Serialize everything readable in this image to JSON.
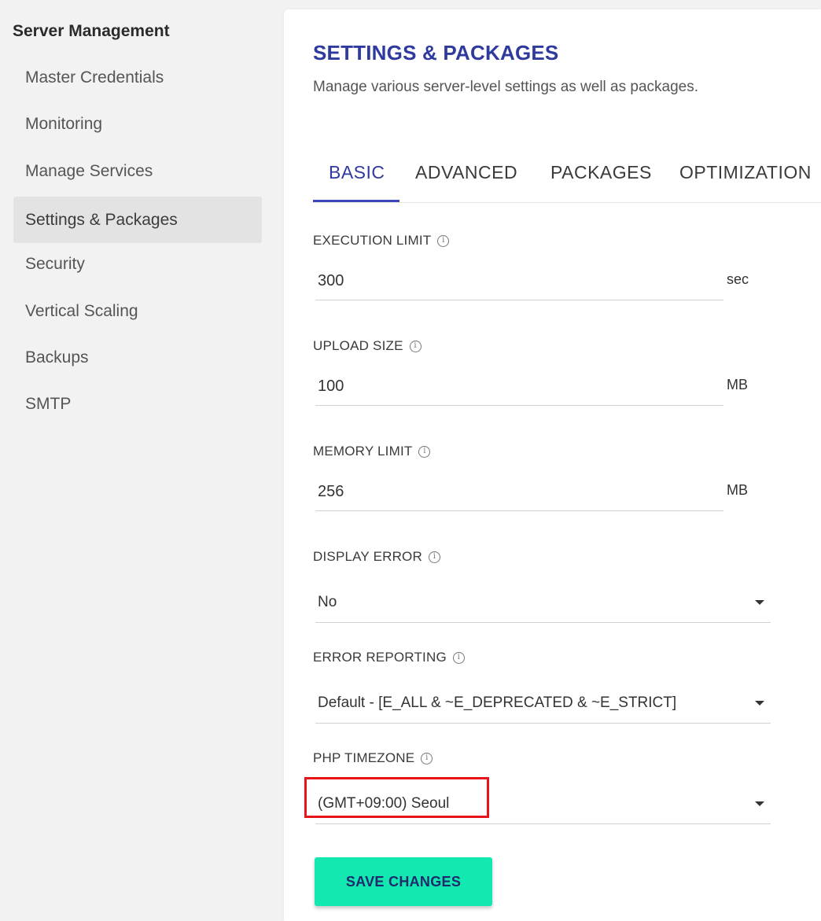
{
  "sidebar": {
    "title": "Server Management",
    "items": [
      {
        "label": "Master Credentials"
      },
      {
        "label": "Monitoring"
      },
      {
        "label": "Manage Services"
      },
      {
        "label": "Settings & Packages"
      },
      {
        "label": "Security"
      },
      {
        "label": "Vertical Scaling"
      },
      {
        "label": "Backups"
      },
      {
        "label": "SMTP"
      }
    ]
  },
  "main": {
    "title": "SETTINGS & PACKAGES",
    "subtitle": "Manage various server-level settings as well as packages.",
    "tabs": [
      {
        "label": "BASIC"
      },
      {
        "label": "ADVANCED"
      },
      {
        "label": "PACKAGES"
      },
      {
        "label": "OPTIMIZATION"
      }
    ],
    "fields": {
      "execution_limit": {
        "label": "EXECUTION LIMIT",
        "value": "300",
        "unit": "sec"
      },
      "upload_size": {
        "label": "UPLOAD SIZE",
        "value": "100",
        "unit": "MB"
      },
      "memory_limit": {
        "label": "MEMORY LIMIT",
        "value": "256",
        "unit": "MB"
      },
      "display_error": {
        "label": "DISPLAY ERROR",
        "value": "No"
      },
      "error_reporting": {
        "label": "ERROR REPORTING",
        "value": "Default - [E_ALL & ~E_DEPRECATED & ~E_STRICT]"
      },
      "php_timezone": {
        "label": "PHP TIMEZONE",
        "value": "(GMT+09:00) Seoul"
      }
    },
    "save_label": "SAVE CHANGES"
  },
  "colors": {
    "accent": "#2f3a9e",
    "tab_underline": "#3b46b8",
    "save_button": "#13e8b0",
    "highlight": "#e8141b",
    "active_sidebar_bg": "#e3e3e3"
  },
  "icons": {
    "info": "info-icon",
    "caret": "caret-down-icon"
  }
}
